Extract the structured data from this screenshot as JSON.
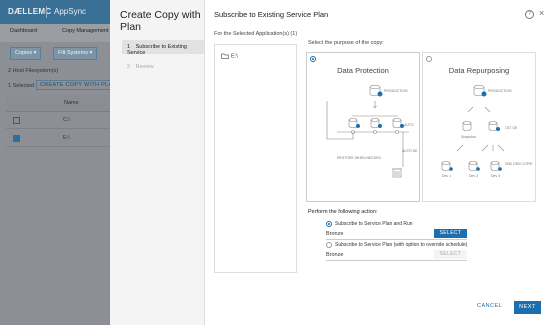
{
  "app": {
    "brand": "DÆLLEMC",
    "name": "AppSync",
    "nav_tabs": [
      "Dashboard",
      "Copy Management"
    ],
    "toolbar": {
      "copies_label": "Copies ▾",
      "filter_label": "Filt Systems ▾"
    },
    "host_count": "2 Host Filesystem(s)",
    "selected_count": "1 Selected",
    "create_link": "CREATE COPY WITH PLAN",
    "grid": {
      "name_header": "Name",
      "rows": [
        {
          "name": "C:\\",
          "checked": false
        },
        {
          "name": "E:\\",
          "checked": true
        }
      ]
    }
  },
  "modal": {
    "title": "Create Copy with Plan",
    "steps": [
      {
        "num": "1",
        "label": "Subscribe to Existing Service",
        "active": true
      },
      {
        "num": "2",
        "label": "Review",
        "active": false
      }
    ],
    "main_title": "Subscribe to Existing Service Plan",
    "selected_apps_label": "For the Selected Application(s) (1)",
    "apps": [
      "E:\\"
    ],
    "purpose_label": "Select the purpose of the copy:",
    "purposes": [
      {
        "title": "Data Protection",
        "selected": true,
        "labels": {
          "production": "PRODUCTION",
          "auto": "AUTO",
          "restore": "RESTORE WHEN NEEDED",
          "auto_del": "AUTO DE"
        }
      },
      {
        "title": "Data Repurposing",
        "selected": false,
        "labels": {
          "production": "PRODUCTION",
          "first_gen": "1ST GE",
          "snapshot": "Snapshot",
          "second_gen": "2ND GEN COPIE",
          "devs": [
            "Dev 1",
            "Dev 2",
            "Dev 3"
          ]
        }
      }
    ],
    "action_label": "Perform the following action:",
    "options": [
      {
        "label": "Subscribe to Service Plan and Run",
        "selected": true,
        "plan": "Bronze",
        "button": "SELECT",
        "button_enabled": true
      },
      {
        "label": "Subscribe to Service Plan (with option to override schedule)",
        "selected": false,
        "plan": "Bronze",
        "button": "SELECT",
        "button_enabled": false
      }
    ],
    "cancel_label": "CANCEL",
    "next_label": "NEXT",
    "help_icon": "?",
    "close_icon": "×"
  },
  "colors": {
    "accent": "#1b6fae",
    "header": "#3a6f96"
  }
}
